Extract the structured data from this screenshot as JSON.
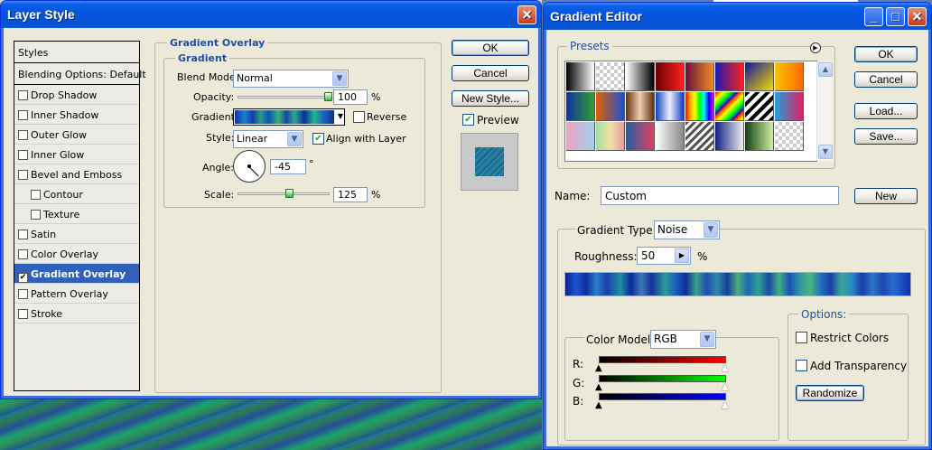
{
  "layer_style": {
    "title": "Layer Style",
    "styles_list": [
      {
        "label": "Styles",
        "header": true
      },
      {
        "label": "Blending Options: Default",
        "header": true
      },
      {
        "label": "Drop Shadow",
        "checked": false
      },
      {
        "label": "Inner Shadow",
        "checked": false
      },
      {
        "label": "Outer Glow",
        "checked": false
      },
      {
        "label": "Inner Glow",
        "checked": false
      },
      {
        "label": "Bevel and Emboss",
        "checked": false
      },
      {
        "label": "Contour",
        "checked": false,
        "indent": true
      },
      {
        "label": "Texture",
        "checked": false,
        "indent": true
      },
      {
        "label": "Satin",
        "checked": false
      },
      {
        "label": "Color Overlay",
        "checked": false
      },
      {
        "label": "Gradient Overlay",
        "checked": true,
        "selected": true
      },
      {
        "label": "Pattern Overlay",
        "checked": false
      },
      {
        "label": "Stroke",
        "checked": false
      }
    ],
    "panel_title": "Gradient Overlay",
    "group_title": "Gradient",
    "blend_mode_label": "Blend Mode:",
    "blend_mode_value": "Normal",
    "opacity_label": "Opacity:",
    "opacity_value": "100",
    "opacity_fraction": 1.0,
    "percent": "%",
    "gradient_label": "Gradient:",
    "reverse_label": "Reverse",
    "style_label": "Style:",
    "style_value": "Linear",
    "align_label": "Align with Layer",
    "angle_label": "Angle:",
    "angle_value": "-45",
    "degree": "°",
    "scale_label": "Scale:",
    "scale_value": "125",
    "scale_fraction": 0.55,
    "ok": "OK",
    "cancel": "Cancel",
    "new_style": "New Style...",
    "preview_label": "Preview",
    "preview_checked": true
  },
  "gradient_editor": {
    "title": "Gradient Editor",
    "presets_label": "Presets",
    "ok": "OK",
    "cancel": "Cancel",
    "load": "Load...",
    "save": "Save...",
    "name_label": "Name:",
    "name_value": "Custom",
    "new_button": "New",
    "gradient_type_label": "Gradient Type:",
    "gradient_type_value": "Noise",
    "roughness_label": "Roughness:",
    "roughness_value": "50",
    "percent": "%",
    "color_model_label": "Color Model:",
    "color_model_value": "RGB",
    "channel_r": "R:",
    "channel_g": "G:",
    "channel_b": "B:",
    "options_label": "Options:",
    "restrict_colors": "Restrict Colors",
    "add_transparency": "Add Transparency",
    "randomize": "Randomize"
  },
  "colors": {
    "xp_title_blue": "#0554e0",
    "selection_blue": "#3160b8",
    "group_title_blue": "#1f4fa3"
  }
}
